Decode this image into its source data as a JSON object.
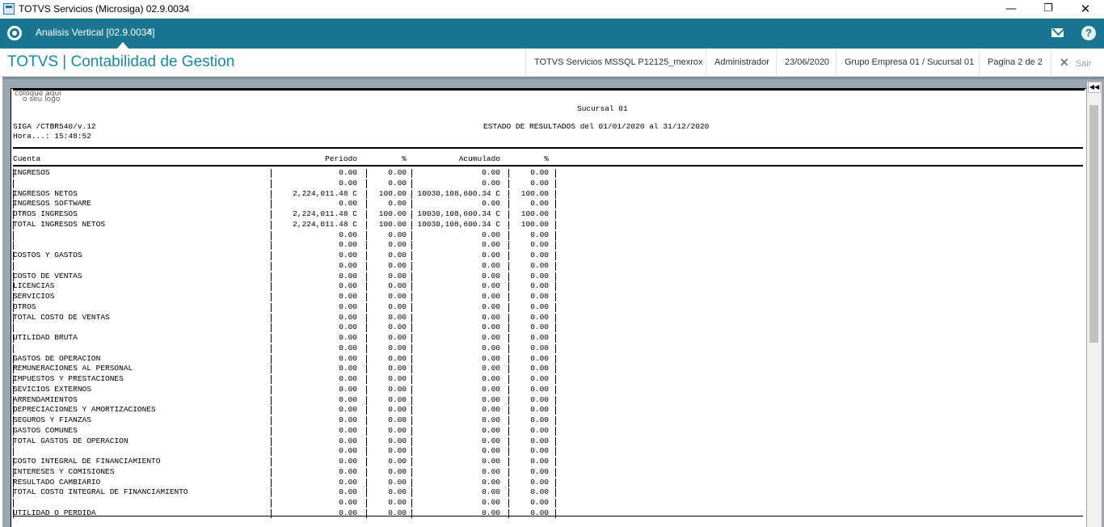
{
  "window": {
    "title": "TOTVS Servicios (Microsiga) 02.9.0034",
    "min_symbol": "—",
    "max_symbol": "❐",
    "close_symbol": "✕"
  },
  "tabs": [
    {
      "label": "Analisis Vertical [02.9.0034]",
      "close": "×"
    }
  ],
  "header": {
    "app_name": "TOTVS | Contabilidad de Gestion",
    "environment": "TOTVS Servicios MSSQL P12125_mexrox",
    "user": "Administrador",
    "date": "23/06/2020",
    "company": "Grupo Empresa 01 / Sucursal 01",
    "page": "Pagina 2 de 2",
    "exit_label": "Sair"
  },
  "icons": {
    "logo": "totvs-logo-icon",
    "mail": "mail-icon",
    "help": "help-icon",
    "help_glyph": "?",
    "scroll_up_glyph": "◀◀"
  },
  "colors": {
    "tabbar": "#1a7690",
    "app_name": "#1a86a8"
  },
  "report": {
    "logo_line1": "coloque aqui",
    "logo_line2": "o seu logo",
    "branch": "Sucursal 01",
    "program": "SIGA /CTBR540/v.12",
    "time": "Hora...: 15:48:52",
    "title": "ESTADO DE RESULTADOS del 01/01/2020 al 31/12/2020",
    "columns": {
      "cuenta": "Cuenta",
      "periodo": "Periodo",
      "pct1": "%",
      "acumulado": "Acumulado",
      "pct2": "%"
    },
    "rows": [
      {
        "cuenta": "INGRESOS",
        "periodo": "0.00",
        "pct1": "0.00",
        "acumulado": "0.00",
        "pct2": "0.00"
      },
      {
        "cuenta": "",
        "periodo": "0.00",
        "pct1": "0.00",
        "acumulado": "0.00",
        "pct2": "0.00"
      },
      {
        "cuenta": "INGRESOS NETOS",
        "periodo": "2,224,011.48 C",
        "pct1": "100.00",
        "acumulado": "10030,108,600.34 C",
        "pct2": "100.00"
      },
      {
        "cuenta": "INGRESOS SOFTWARE",
        "periodo": "0.00",
        "pct1": "0.00",
        "acumulado": "0.00",
        "pct2": "0.00"
      },
      {
        "cuenta": "OTROS INGRESOS",
        "periodo": "2,224,011.48 C",
        "pct1": "100.00",
        "acumulado": "10030,108,600.34 C",
        "pct2": "100.00"
      },
      {
        "cuenta": "TOTAL INGRESOS NETOS",
        "periodo": "2,224,011.48 C",
        "pct1": "100.00",
        "acumulado": "10030,108,600.34 C",
        "pct2": "100.00"
      },
      {
        "cuenta": "",
        "periodo": "0.00",
        "pct1": "0.00",
        "acumulado": "0.00",
        "pct2": "0.00"
      },
      {
        "cuenta": "",
        "periodo": "0.00",
        "pct1": "0.00",
        "acumulado": "0.00",
        "pct2": "0.00"
      },
      {
        "cuenta": "COSTOS Y GASTOS",
        "periodo": "0.00",
        "pct1": "0.00",
        "acumulado": "0.00",
        "pct2": "0.00"
      },
      {
        "cuenta": "",
        "periodo": "0.00",
        "pct1": "0.00",
        "acumulado": "0.00",
        "pct2": "0.00"
      },
      {
        "cuenta": "COSTO DE VENTAS",
        "periodo": "0.00",
        "pct1": "0.00",
        "acumulado": "0.00",
        "pct2": "0.00"
      },
      {
        "cuenta": "LICENCIAS",
        "periodo": "0.00",
        "pct1": "0.00",
        "acumulado": "0.00",
        "pct2": "0.00"
      },
      {
        "cuenta": "SERVICIOS",
        "periodo": "0.00",
        "pct1": "0.00",
        "acumulado": "0.00",
        "pct2": "0.00"
      },
      {
        "cuenta": "OTROS",
        "periodo": "0.00",
        "pct1": "0.00",
        "acumulado": "0.00",
        "pct2": "0.00"
      },
      {
        "cuenta": "TOTAL COSTO DE VENTAS",
        "periodo": "0.00",
        "pct1": "0.00",
        "acumulado": "0.00",
        "pct2": "0.00"
      },
      {
        "cuenta": "",
        "periodo": "0.00",
        "pct1": "0.00",
        "acumulado": "0.00",
        "pct2": "0.00"
      },
      {
        "cuenta": "UTILIDAD BRUTA",
        "periodo": "0.00",
        "pct1": "0.00",
        "acumulado": "0.00",
        "pct2": "0.00"
      },
      {
        "cuenta": "",
        "periodo": "0.00",
        "pct1": "0.00",
        "acumulado": "0.00",
        "pct2": "0.00"
      },
      {
        "cuenta": "GASTOS DE OPERACION",
        "periodo": "0.00",
        "pct1": "0.00",
        "acumulado": "0.00",
        "pct2": "0.00"
      },
      {
        "cuenta": "REMUNERACIONES AL PERSONAL",
        "periodo": "0.00",
        "pct1": "0.00",
        "acumulado": "0.00",
        "pct2": "0.00"
      },
      {
        "cuenta": "IMPUESTOS Y PRESTACIONES",
        "periodo": "0.00",
        "pct1": "0.00",
        "acumulado": "0.00",
        "pct2": "0.00"
      },
      {
        "cuenta": "SEVICIOS EXTERNOS",
        "periodo": "0.00",
        "pct1": "0.00",
        "acumulado": "0.00",
        "pct2": "0.00"
      },
      {
        "cuenta": "ARRENDAMIENTOS",
        "periodo": "0.00",
        "pct1": "0.00",
        "acumulado": "0.00",
        "pct2": "0.00"
      },
      {
        "cuenta": "DEPRECIACIONES Y AMORTIZACIONES",
        "periodo": "0.00",
        "pct1": "0.00",
        "acumulado": "0.00",
        "pct2": "0.00"
      },
      {
        "cuenta": "SEGUROS Y FIANZAS",
        "periodo": "0.00",
        "pct1": "0.00",
        "acumulado": "0.00",
        "pct2": "0.00"
      },
      {
        "cuenta": "GASTOS COMUNES",
        "periodo": "0.00",
        "pct1": "0.00",
        "acumulado": "0.00",
        "pct2": "0.00"
      },
      {
        "cuenta": "TOTAL GASTOS DE OPERACION",
        "periodo": "0.00",
        "pct1": "0.00",
        "acumulado": "0.00",
        "pct2": "0.00"
      },
      {
        "cuenta": "",
        "periodo": "0.00",
        "pct1": "0.00",
        "acumulado": "0.00",
        "pct2": "0.00"
      },
      {
        "cuenta": "COSTO INTEGRAL DE FINANCIAMIENTO",
        "periodo": "0.00",
        "pct1": "0.00",
        "acumulado": "0.00",
        "pct2": "0.00"
      },
      {
        "cuenta": "INTERESES Y COMISIONES",
        "periodo": "0.00",
        "pct1": "0.00",
        "acumulado": "0.00",
        "pct2": "0.00"
      },
      {
        "cuenta": "RESULTADO CAMBIARIO",
        "periodo": "0.00",
        "pct1": "0.00",
        "acumulado": "0.00",
        "pct2": "0.00"
      },
      {
        "cuenta": "TOTAL COSTO INTEGRAL DE FINANCIAMIENTO",
        "periodo": "0.00",
        "pct1": "0.00",
        "acumulado": "0.00",
        "pct2": "0.00"
      },
      {
        "cuenta": "",
        "periodo": "0.00",
        "pct1": "0.00",
        "acumulado": "0.00",
        "pct2": "0.00"
      },
      {
        "cuenta": "UTILIDAD O PERDIDA",
        "periodo": "0.00",
        "pct1": "0.00",
        "acumulado": "0.00",
        "pct2": "0.00"
      }
    ]
  }
}
